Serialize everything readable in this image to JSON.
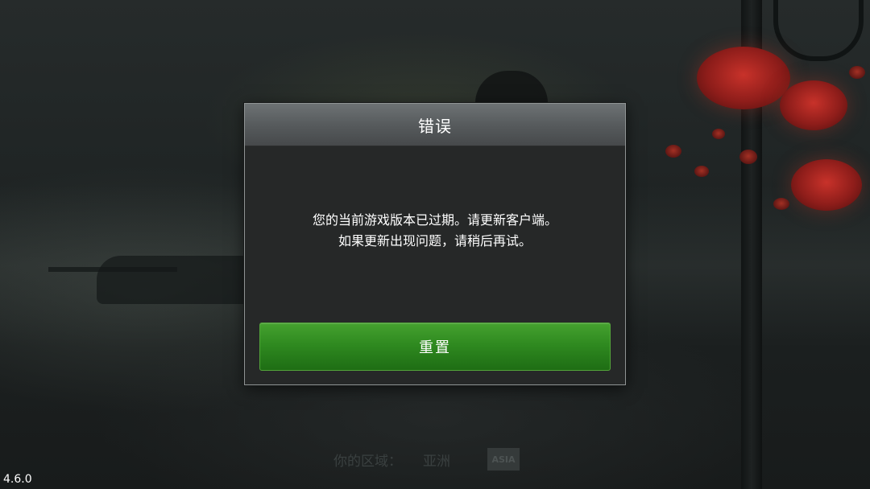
{
  "dialog": {
    "title": "错误",
    "message_line1": "您的当前游戏版本已过期。请更新客户端。",
    "message_line2": "如果更新出现问题，请稍后再试。",
    "button_label": "重置"
  },
  "footer": {
    "region_label": "你的区域：",
    "region_value": "亚洲",
    "region_badge": "ASIA",
    "version": "4.6.0"
  },
  "colors": {
    "button_green": "#2f8a20",
    "dialog_bg": "#262828",
    "header_gray": "#575b5d"
  }
}
